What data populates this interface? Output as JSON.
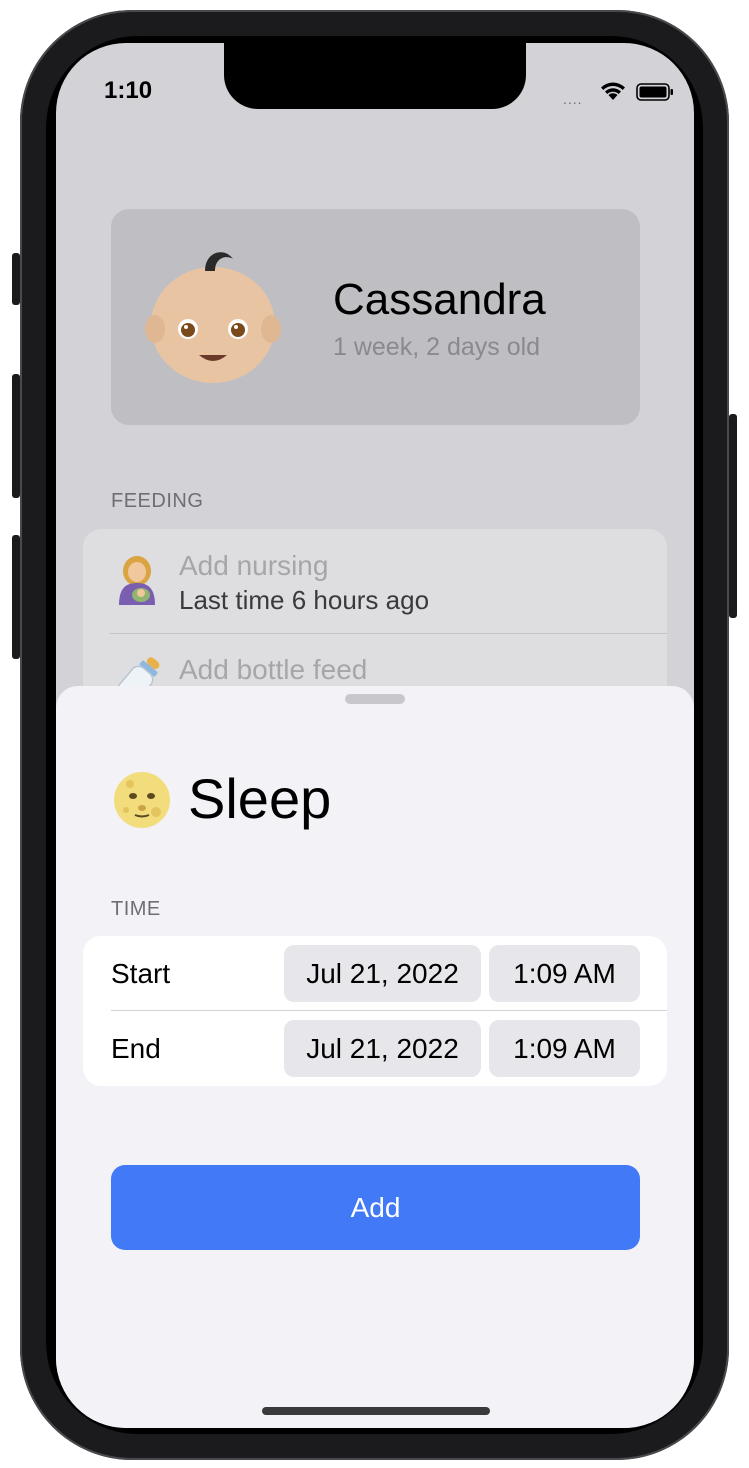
{
  "status_bar": {
    "time": "1:10",
    "signal": "....",
    "wifi_icon": "wifi-icon",
    "battery_icon": "battery-icon"
  },
  "profile": {
    "avatar_icon": "baby-face-icon",
    "name": "Cassandra",
    "age": "1 week, 2 days old"
  },
  "feeding": {
    "section_label": "FEEDING",
    "items": [
      {
        "icon": "breastfeeding-icon",
        "title": "Add nursing",
        "subtitle": "Last time 6 hours ago"
      },
      {
        "icon": "baby-bottle-icon",
        "title": "Add bottle feed"
      }
    ]
  },
  "sheet": {
    "title_icon": "full-moon-face-icon",
    "title": "Sleep",
    "time_section_label": "TIME",
    "rows": [
      {
        "label": "Start",
        "date": "Jul 21, 2022",
        "time": "1:09 AM"
      },
      {
        "label": "End",
        "date": "Jul 21, 2022",
        "time": "1:09 AM"
      }
    ],
    "add_button": "Add"
  },
  "colors": {
    "accent": "#4179f6",
    "sheet_background": "#f2f2f7",
    "dimmed_background": "#d2d2d7"
  }
}
